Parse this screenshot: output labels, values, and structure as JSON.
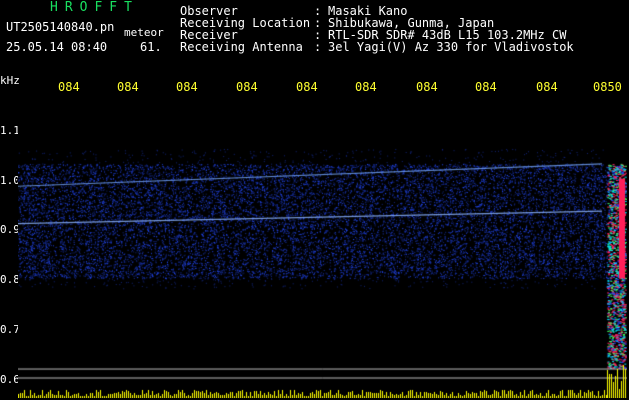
{
  "header": {
    "brand": "HROFFT",
    "filename": "UT2505140840.pn",
    "mode": "meteor",
    "timestamp": "25.05.14 08:40",
    "number": "61.",
    "meta": [
      {
        "label": "Observer",
        "value": "Masaki Kano"
      },
      {
        "label": "Receiving Location",
        "value": "Shibukawa, Gunma, Japan"
      },
      {
        "label": "Receiver",
        "value": "RTL-SDR SDR# 43dB L15 103.2MHz CW"
      },
      {
        "label": "Receiving Antenna",
        "value": "3el Yagi(V) Az 330 for Vladivostok"
      }
    ]
  },
  "spectrogram": {
    "unit_label": "kHz",
    "y_ticks": [
      "1.1",
      "1.0",
      "0.9",
      "0.8",
      "0.7",
      "0.6"
    ],
    "x_ticks": [
      "084",
      "084",
      "084",
      "084",
      "084",
      "084",
      "084",
      "084",
      "084",
      "0850"
    ],
    "colors": {
      "background": "#000000",
      "noise": "#1a3cff",
      "trace": "#7fb4ff",
      "hot": "#ff1f5a",
      "axis_ticks": "#ffff30",
      "bars": "#ffff00"
    }
  }
}
